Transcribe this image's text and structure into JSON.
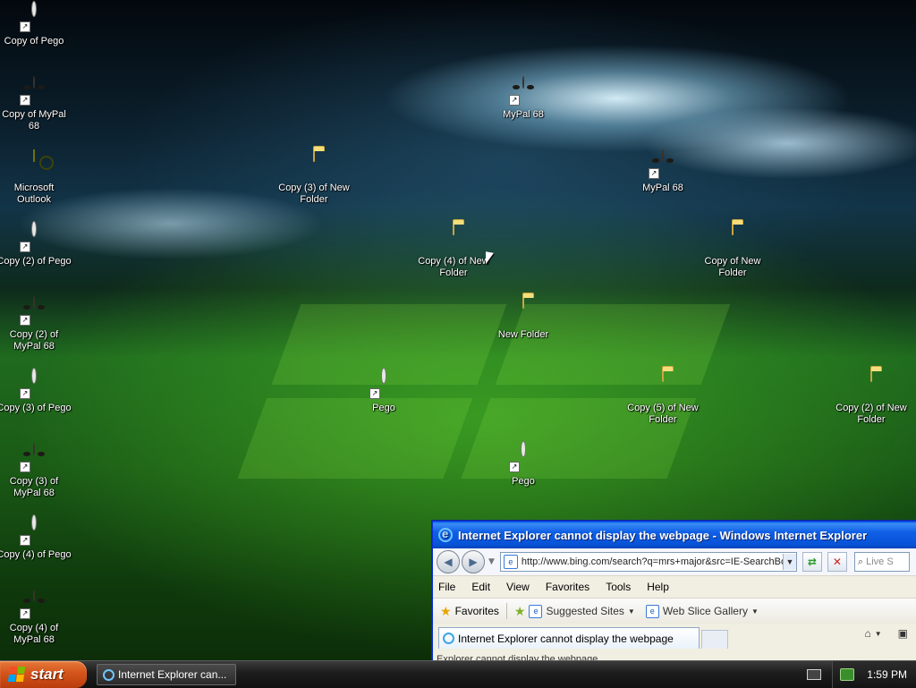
{
  "desktop": {
    "icons": [
      {
        "label": "Copy of Pego"
      },
      {
        "label": "Copy of MyPal 68"
      },
      {
        "label": "Microsoft Outlook"
      },
      {
        "label": "Copy (2) of Pego"
      },
      {
        "label": "Copy (2) of MyPal 68"
      },
      {
        "label": "Copy (3) of Pego"
      },
      {
        "label": "Copy (3) of MyPal 68"
      },
      {
        "label": "Copy (4) of Pego"
      },
      {
        "label": "Copy (4) of MyPal 68"
      },
      {
        "label": "MyPal 68"
      },
      {
        "label": "MyPal 68"
      },
      {
        "label": "Copy (3) of New Folder"
      },
      {
        "label": "Copy (4) of New Folder"
      },
      {
        "label": "Copy of New Folder"
      },
      {
        "label": "New Folder"
      },
      {
        "label": "Pego"
      },
      {
        "label": "Copy (5) of New Folder"
      },
      {
        "label": "Copy (2) of New Folder"
      },
      {
        "label": "Pego"
      }
    ]
  },
  "browser": {
    "title": "Internet Explorer cannot display the webpage - Windows Internet Explorer",
    "address": "http://www.bing.com/search?q=mrs+major&src=IE-SearchBox",
    "search_placeholder": "Live S",
    "menu": [
      "File",
      "Edit",
      "View",
      "Favorites",
      "Tools",
      "Help"
    ],
    "favorites_label": "Favorites",
    "suggested_sites": "Suggested Sites",
    "web_slice_gallery": "Web Slice Gallery",
    "tab_label": "Internet Explorer cannot display the webpage",
    "content_text": "Explorer cannot display the webpage"
  },
  "taskbar": {
    "start_label": "start",
    "task_label": "Internet Explorer can...",
    "clock": "1:59 PM"
  }
}
